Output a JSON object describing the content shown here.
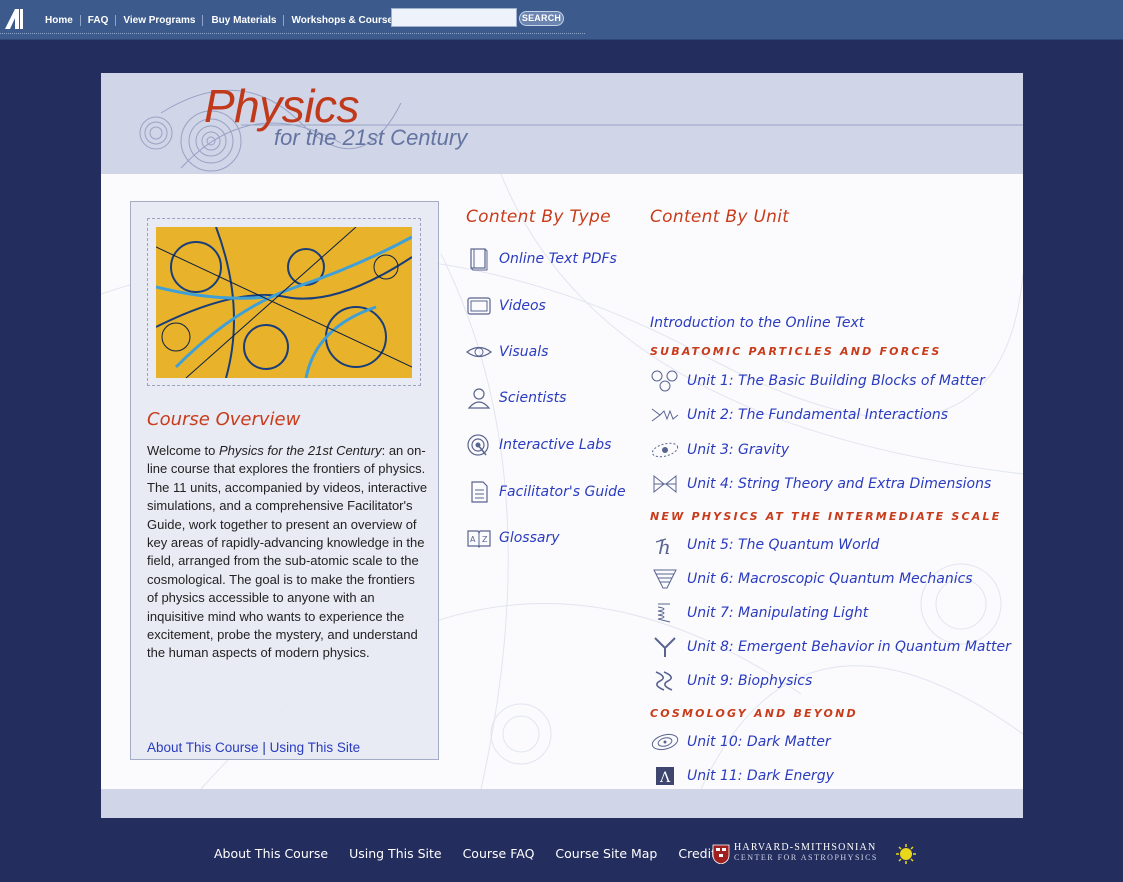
{
  "topnav": {
    "links": [
      "Home",
      "FAQ",
      "View Programs",
      "Buy Materials",
      "Workshops & Courses"
    ],
    "search_value": "",
    "search_button": "SEARCH"
  },
  "banner": {
    "title": "Physics",
    "subtitle": "for the 21st Century"
  },
  "overview": {
    "heading": "Course Overview",
    "text_intro": "Welcome to ",
    "text_title": "Physics for the 21st Century",
    "text_body": ": an on-line course that explores the frontiers of physics. The 11 units, accompanied by videos, interactive simulations, and a comprehensive Facilitator's Guide, work together to present an overview of key areas of rapidly-advancing knowledge in the field, arranged from the sub-atomic scale to the cosmological. The goal is to make the frontiers of physics accessible to anyone with an inquisitive mind who wants to experience the excitement, probe the mystery, and understand the human aspects of modern physics.",
    "link_about": "About This Course",
    "link_sep": "|",
    "link_using": "Using This Site"
  },
  "content_by_type": {
    "heading": "Content By Type",
    "items": [
      {
        "label": "Online Text PDFs",
        "icon": "book-icon"
      },
      {
        "label": "Videos",
        "icon": "monitor-icon"
      },
      {
        "label": "Visuals",
        "icon": "eye-icon"
      },
      {
        "label": "Scientists",
        "icon": "person-icon"
      },
      {
        "label": "Interactive Labs",
        "icon": "target-icon"
      },
      {
        "label": "Facilitator's Guide",
        "icon": "document-icon"
      },
      {
        "label": "Glossary",
        "icon": "open-book-icon"
      }
    ]
  },
  "content_by_unit": {
    "heading": "Content By Unit",
    "intro": "Introduction to the Online Text",
    "sections": [
      {
        "title": "SUBATOMIC PARTICLES AND FORCES"
      },
      {
        "title": "NEW PHYSICS AT THE INTERMEDIATE SCALE"
      },
      {
        "title": "COSMOLOGY AND BEYOND"
      }
    ],
    "units": [
      {
        "label": "Unit 1: The Basic Building Blocks of Matter",
        "icon": "particles-icon"
      },
      {
        "label": "Unit 2: The Fundamental Interactions",
        "icon": "interaction-icon"
      },
      {
        "label": "Unit 3: Gravity",
        "icon": "orbit-icon"
      },
      {
        "label": "Unit 4: String Theory and Extra Dimensions",
        "icon": "strings-icon"
      },
      {
        "label": "Unit 5: The Quantum World",
        "icon": "h-bar-icon"
      },
      {
        "label": "Unit 6: Macroscopic Quantum Mechanics",
        "icon": "funnel-icon"
      },
      {
        "label": "Unit 7: Manipulating Light",
        "icon": "spring-icon"
      },
      {
        "label": "Unit 8: Emergent Behavior in Quantum Matter",
        "icon": "y-branch-icon"
      },
      {
        "label": "Unit 9: Biophysics",
        "icon": "helix-icon"
      },
      {
        "label": "Unit 10: Dark Matter",
        "icon": "galaxy-icon"
      },
      {
        "label": "Unit 11: Dark Energy",
        "icon": "lambda-icon"
      }
    ]
  },
  "footer": {
    "links": [
      "About This Course",
      "Using This Site",
      "Course FAQ",
      "Course Site Map",
      "Credits"
    ],
    "partner_line1": "HARVARD-SMITHSONIAN",
    "partner_line2": "CENTER FOR ASTROPHYSICS"
  },
  "colors": {
    "background": "#232d5e",
    "nav": "#3c5a8c",
    "accent_red": "#c83c1c",
    "link_blue": "#2a3bbf"
  }
}
